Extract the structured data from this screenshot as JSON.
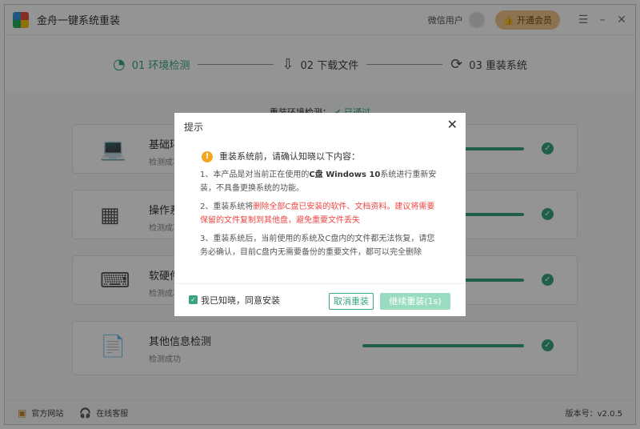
{
  "app": {
    "title": "金舟一键系统重装",
    "user": "微信用户",
    "vip_label": "开通会员",
    "menu_icon": "menu-icon",
    "min_icon": "minimize-icon",
    "close_icon": "close-icon"
  },
  "steps": [
    {
      "label": "01 环境检测",
      "active": true
    },
    {
      "label": "02 下载文件"
    },
    {
      "label": "03 重装系统"
    }
  ],
  "env": {
    "label": "重装环境检测：",
    "status": "已通过"
  },
  "cards": [
    {
      "title": "基础环境检测",
      "status": "检测成功",
      "progress": 100
    },
    {
      "title": "操作系统检测",
      "status": "检测成功",
      "progress": 100
    },
    {
      "title": "软硬件检测",
      "status": "检测成功",
      "progress": 100
    },
    {
      "title": "其他信息检测",
      "status": "检测成功",
      "progress": 100
    }
  ],
  "footer": {
    "website": "官方网站",
    "service": "在线客服",
    "version": "版本号：v2.0.5"
  },
  "dialog": {
    "title": "提示",
    "heading": "重装系统前，请确认知晓以下内容：",
    "p1a": "1、本产品是对当前正在使用的",
    "p1b": "C盘 Windows 10",
    "p1c": "系统进行重新安装，不具备更换系统的功能。",
    "p2a": "2、重装系统将",
    "p2b": "删除全部C盘已安装的软件、文档资料。建议将需要保留的文件复制到其他盘，避免重要文件丢失",
    "p3": "3、重装系统后，当前使用的系统及C盘内的文件都无法恢复，请您务必确认，目前C盘内无需要备份的重要文件，都可以完全删除",
    "agree": "我已知晓，同意安装",
    "agree_checked": true,
    "cancel": "取消重装",
    "continue": "继续重装(1s)"
  },
  "colors": {
    "accent": "#3aa57c",
    "warning": "#f04545"
  }
}
